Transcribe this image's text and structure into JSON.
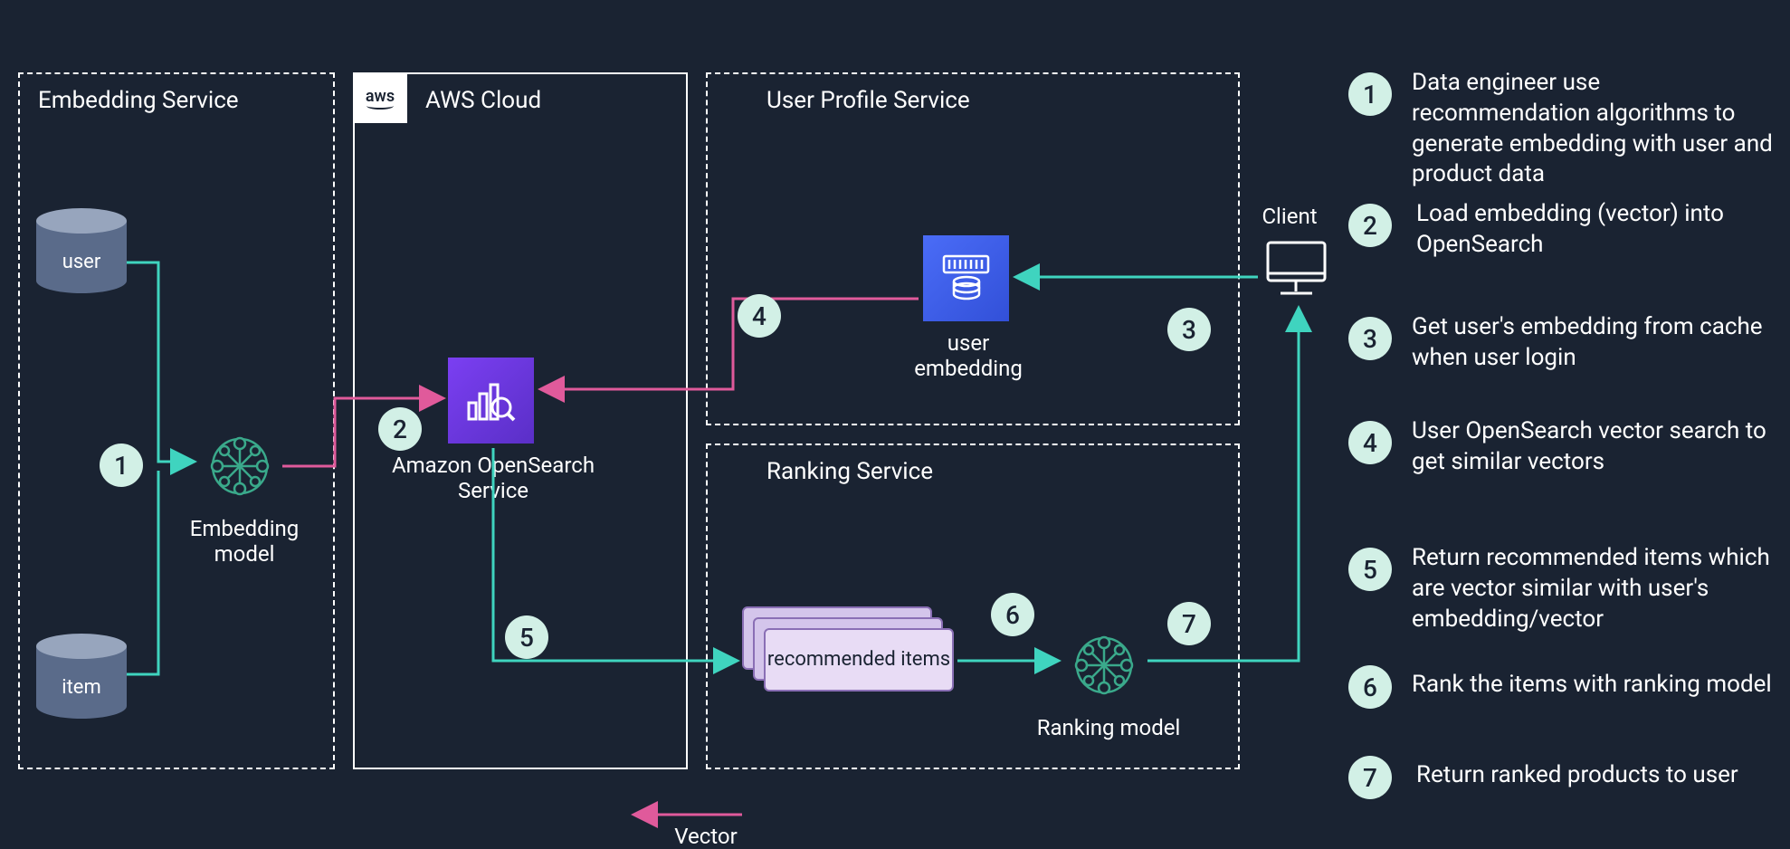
{
  "boxes": {
    "embedding_service": "Embedding Service",
    "aws_cloud": "AWS Cloud",
    "user_profile_service": "User Profile Service",
    "ranking_service": "Ranking Service"
  },
  "aws_badge": "aws",
  "db": {
    "user": "user",
    "item": "item"
  },
  "icons": {
    "embedding_model": "Embedding model",
    "opensearch": "Amazon OpenSearch Service",
    "user_embedding": "user embedding",
    "recommended_items": "recommended items",
    "ranking_model": "Ranking model",
    "client": "Client"
  },
  "vector_label": "Vector",
  "steps": {
    "n1": "1",
    "n2": "2",
    "n3": "3",
    "n4": "4",
    "n5": "5",
    "n6": "6",
    "n7": "7",
    "t1": "Data engineer use recommendation algorithms to generate embedding with  user and product data",
    "t2": "Load embedding (vector) into OpenSearch",
    "t3": "Get user's embedding from cache when user login",
    "t4": "User OpenSearch vector search to get similar vectors",
    "t5": "Return recommended items which are vector similar with user's embedding/vector",
    "t6": "Rank the items with ranking model",
    "t7": "Return ranked products to user"
  }
}
